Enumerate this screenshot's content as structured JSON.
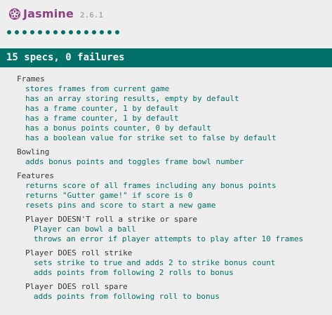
{
  "app": {
    "brand": "Jasmine",
    "version": "2.6.1",
    "brand_color": "#8a4182",
    "accent_color": "#007069",
    "passed_dot_count": 15
  },
  "summary": {
    "text": "15 specs, 0 failures"
  },
  "suites": [
    {
      "title": "Frames",
      "specs": [
        "stores frames from current game",
        "has an array storing results, empty by default",
        "has a frame counter, 1 by default",
        "has a frame counter, 1 by default",
        "has a bonus points counter, 0 by default",
        "has a boolean value for strike set to false by default"
      ]
    },
    {
      "title": "Bowling",
      "specs": [
        "adds bonus points and toggles frame bowl number"
      ]
    },
    {
      "title": "Features",
      "specs": [
        "returns score of all frames including any bonus points",
        "returns \"Gutter game!\" if score is 0",
        "resets pins and score to start a new game"
      ],
      "subsuites": [
        {
          "title": "Player DOESN'T roll a strike or spare",
          "specs": [
            "Player can bowl a ball",
            "throws an error if player attempts to play after 10 frames"
          ]
        },
        {
          "title": "Player DOES roll strike",
          "specs": [
            "sets strike to true and adds 2 to strike bonus count",
            "adds points from following 2 rolls to bonus"
          ]
        },
        {
          "title": "Player DOES roll spare",
          "specs": [
            "adds points from following roll to bonus"
          ]
        }
      ]
    }
  ]
}
